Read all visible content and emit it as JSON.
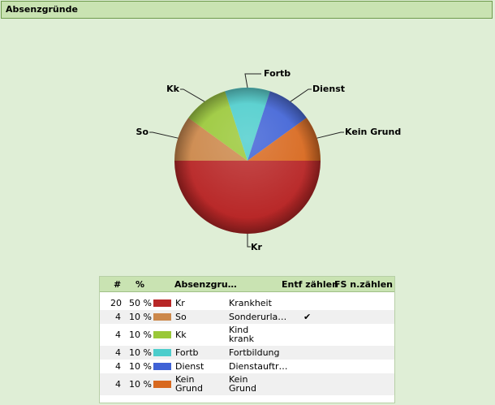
{
  "title": "Absenzgründe",
  "chart_data": {
    "type": "pie",
    "title": "",
    "slices": [
      {
        "label": "Kr",
        "value": 50,
        "color": "#b82727"
      },
      {
        "label": "So",
        "value": 10,
        "color": "#cc884b"
      },
      {
        "label": "Kk",
        "value": 10,
        "color": "#9ac838"
      },
      {
        "label": "Fortb",
        "value": 10,
        "color": "#4ccdcc"
      },
      {
        "label": "Dienst",
        "value": 10,
        "color": "#3f62d6"
      },
      {
        "label": "Kein Grund",
        "value": 10,
        "color": "#d8691f"
      }
    ]
  },
  "legend": {
    "headers": {
      "count": "#",
      "percent": "%",
      "reason": "Absenzgru…",
      "entf": "Entf zählen",
      "fs": "FS n.zählen"
    },
    "rows": [
      {
        "count": "20",
        "percent": "50 %",
        "short": "Kr",
        "name": "Krankheit",
        "entf": "",
        "color": "#b82727"
      },
      {
        "count": "4",
        "percent": "10 %",
        "short": "So",
        "name": "Sonderurla…",
        "entf": "✔",
        "color": "#cc884b"
      },
      {
        "count": "4",
        "percent": "10 %",
        "short": "Kk",
        "name": "Kind krank",
        "entf": "",
        "color": "#9ac838"
      },
      {
        "count": "4",
        "percent": "10 %",
        "short": "Fortb",
        "name": "Fortbildung",
        "entf": "",
        "color": "#4ccdcc"
      },
      {
        "count": "4",
        "percent": "10 %",
        "short": "Dienst",
        "name": "Dienstauftr…",
        "entf": "",
        "color": "#3f62d6"
      },
      {
        "count": "4",
        "percent": "10 %",
        "short": "Kein Grund",
        "name": "Kein Grund",
        "entf": "",
        "color": "#d8691f"
      }
    ]
  }
}
